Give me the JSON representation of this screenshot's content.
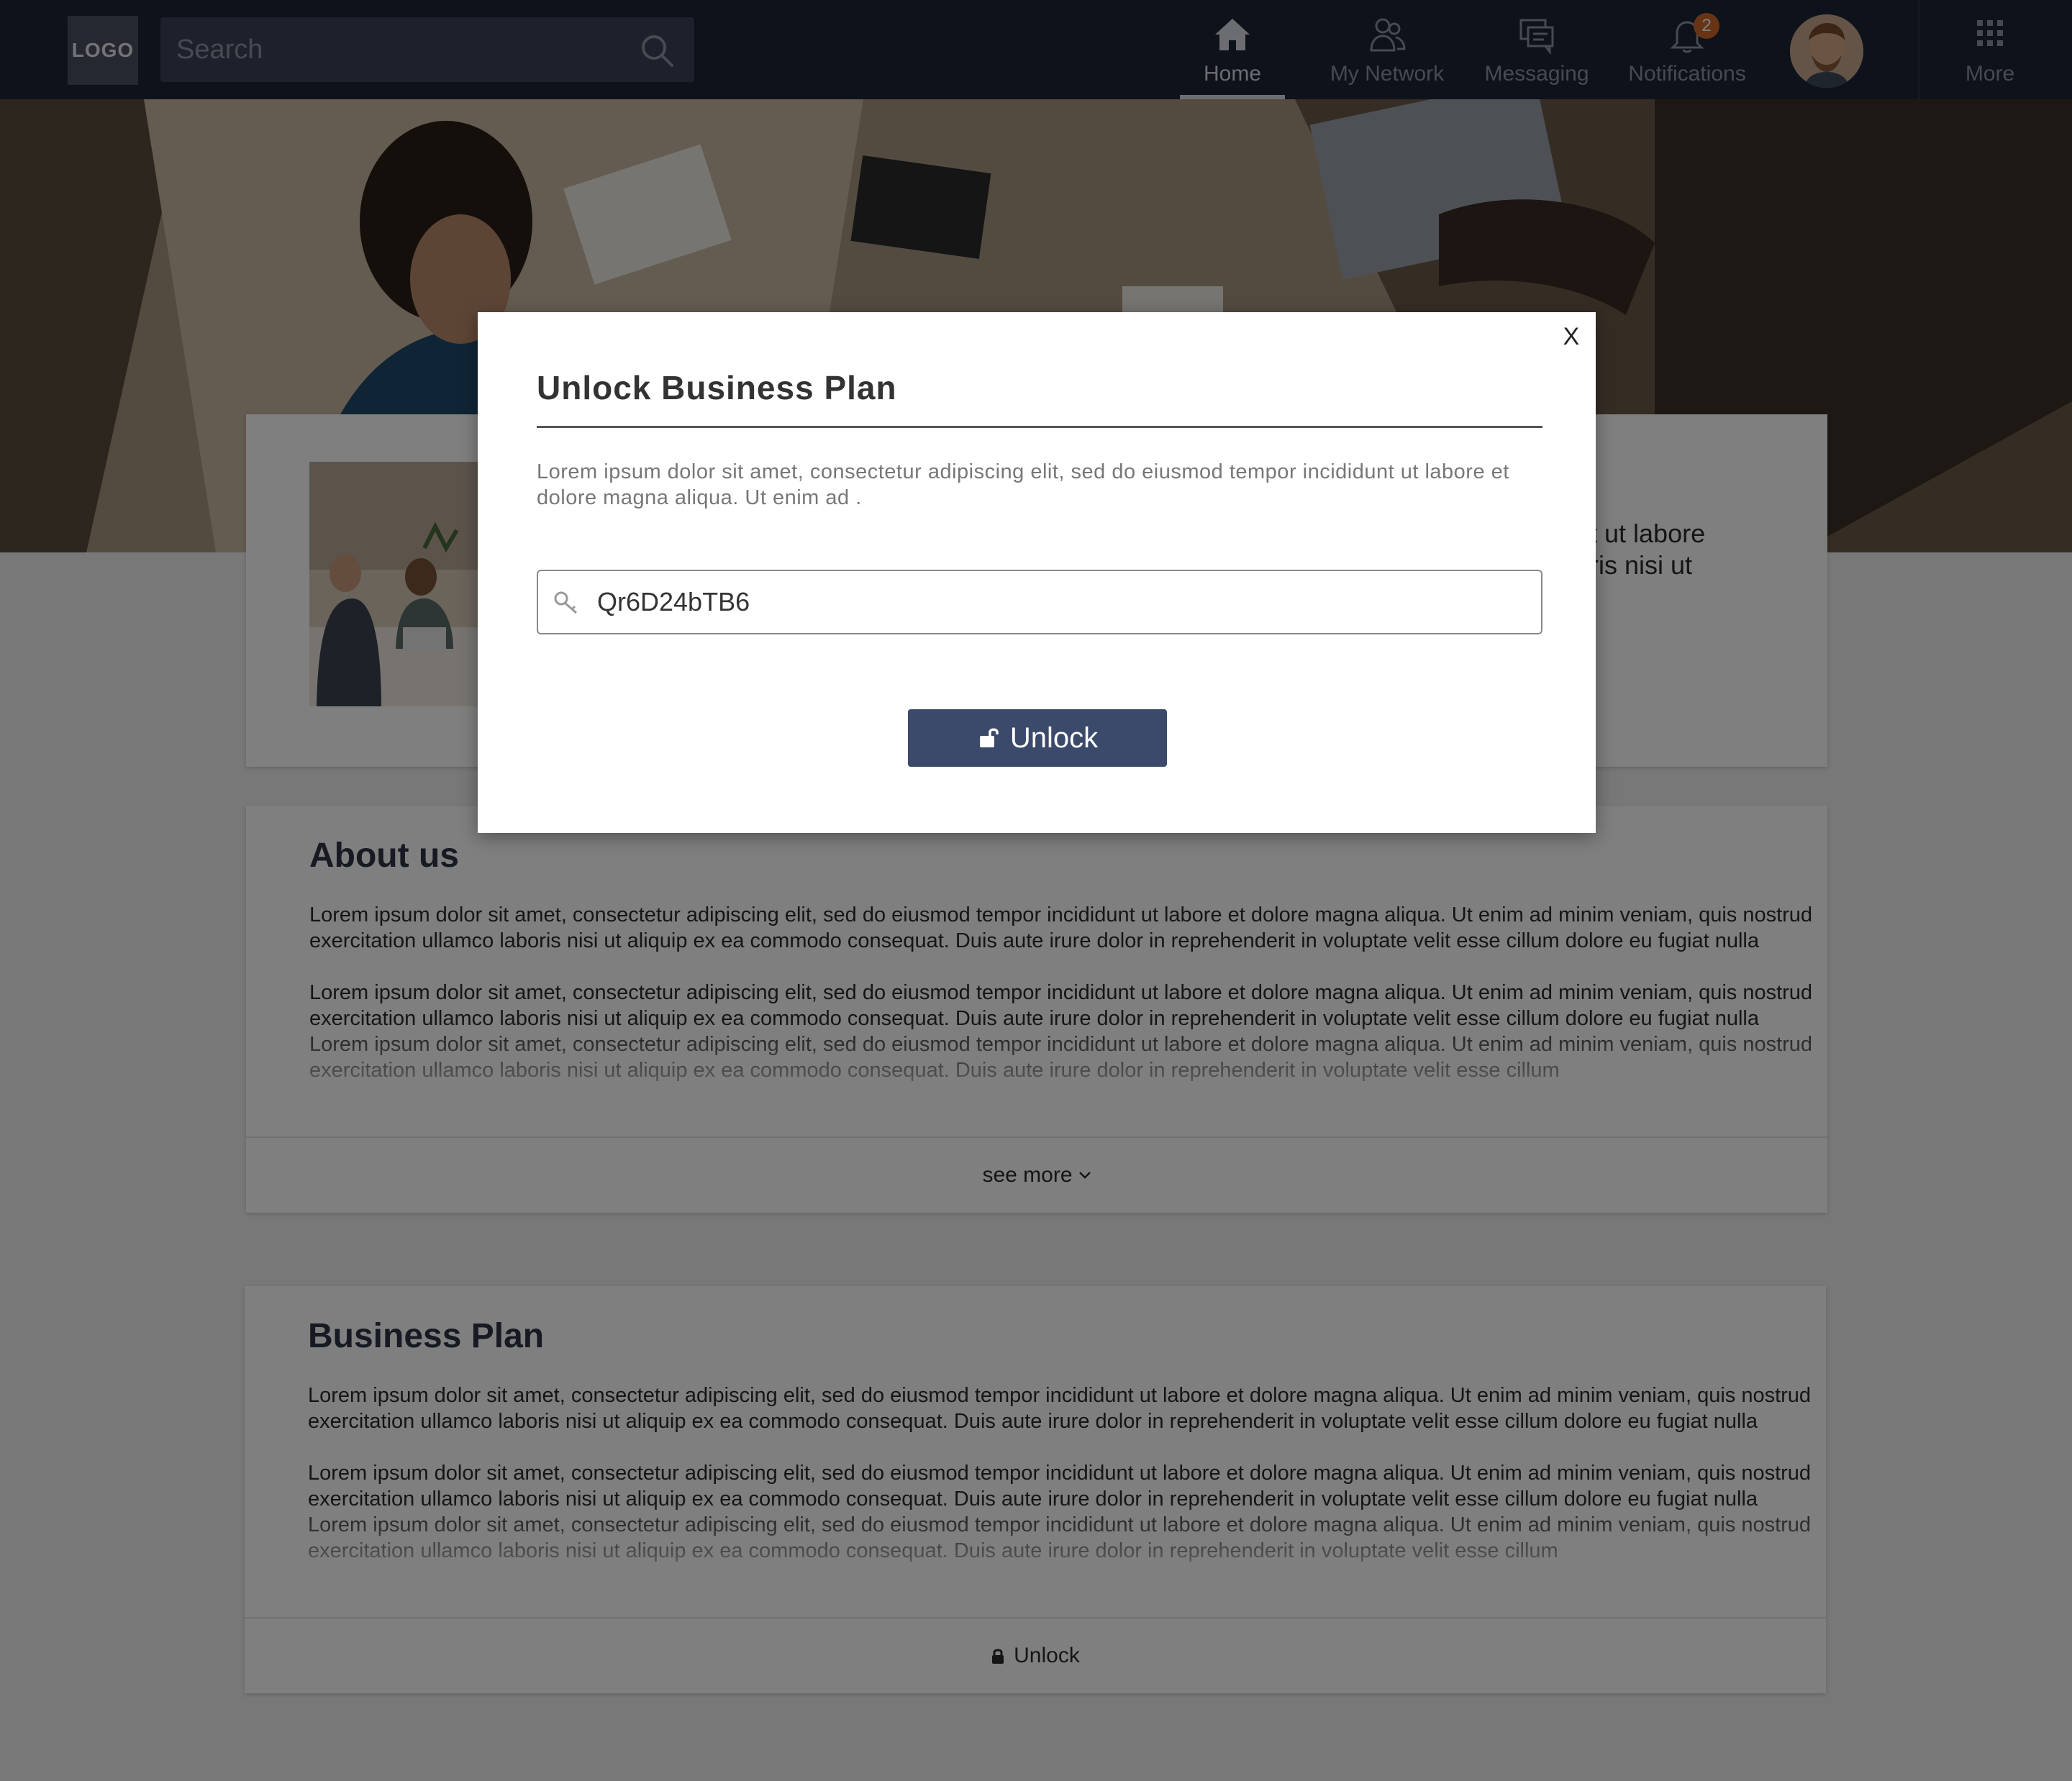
{
  "header": {
    "logo": "LOGO",
    "search_placeholder": "Search",
    "nav": {
      "home": "Home",
      "network": "My Network",
      "messaging": "Messaging",
      "notifications": "Notifications",
      "notifications_badge": "2",
      "more": "More"
    }
  },
  "profile": {
    "snippet_line1": "t ut labore",
    "snippet_line2": "ris nisi ut"
  },
  "about": {
    "title": "About us",
    "paragraphs": [
      "Lorem ipsum dolor sit amet, consectetur adipiscing elit, sed do eiusmod tempor incididunt ut labore et dolore magna aliqua. Ut enim ad minim veniam, quis nostrud exercitation ullamco laboris nisi ut aliquip ex ea commodo consequat. Duis aute irure dolor in reprehenderit in voluptate velit esse cillum dolore eu fugiat nulla",
      "Lorem ipsum dolor sit amet, consectetur adipiscing elit, sed do eiusmod tempor incididunt ut labore et dolore magna aliqua. Ut enim ad minim veniam, quis nostrud exercitation ullamco laboris nisi ut aliquip ex ea commodo consequat. Duis aute irure dolor in reprehenderit in voluptate velit esse cillum dolore eu fugiat nulla Lorem ipsum dolor sit amet, consectetur adipiscing elit, sed do eiusmod tempor incididunt ut labore et dolore magna aliqua. Ut enim ad minim veniam, quis nostrud exercitation ullamco laboris nisi ut aliquip ex ea commodo consequat. Duis aute irure dolor in reprehenderit in voluptate velit esse cillum"
    ],
    "footer_label": "see more"
  },
  "plan": {
    "title": "Business Plan",
    "paragraphs": [
      "Lorem ipsum dolor sit amet, consectetur adipiscing elit, sed do eiusmod tempor incididunt ut labore et dolore magna aliqua. Ut enim ad minim veniam, quis nostrud exercitation ullamco laboris nisi ut aliquip ex ea commodo consequat. Duis aute irure dolor in reprehenderit in voluptate velit esse cillum dolore eu fugiat nulla",
      "Lorem ipsum dolor sit amet, consectetur adipiscing elit, sed do eiusmod tempor incididunt ut labore et dolore magna aliqua. Ut enim ad minim veniam, quis nostrud exercitation ullamco laboris nisi ut aliquip ex ea commodo consequat. Duis aute irure dolor in reprehenderit in voluptate velit esse cillum dolore eu fugiat nulla Lorem ipsum dolor sit amet, consectetur adipiscing elit, sed do eiusmod tempor incididunt ut labore et dolore magna aliqua. Ut enim ad minim veniam, quis nostrud exercitation ullamco laboris nisi ut aliquip ex ea commodo consequat. Duis aute irure dolor in reprehenderit in voluptate velit esse cillum"
    ],
    "footer_label": "Unlock"
  },
  "modal": {
    "close_label": "X",
    "title": "Unlock Business Plan",
    "description": "Lorem ipsum dolor sit amet, consectetur adipiscing elit, sed do eiusmod tempor incididunt ut labore et dolore magna aliqua. Ut enim ad .",
    "key_value": "Qr6D24bTB6",
    "unlock_label": "Unlock"
  },
  "colors": {
    "nav_background": "#1d2436",
    "accent_button": "#3b4a6b",
    "badge": "#d2682c"
  },
  "icons": [
    "search-icon",
    "home-icon",
    "network-icon",
    "messaging-icon",
    "bell-icon",
    "grid-icon",
    "chevron-down-icon",
    "lock-icon",
    "key-icon",
    "lock-open-icon"
  ]
}
